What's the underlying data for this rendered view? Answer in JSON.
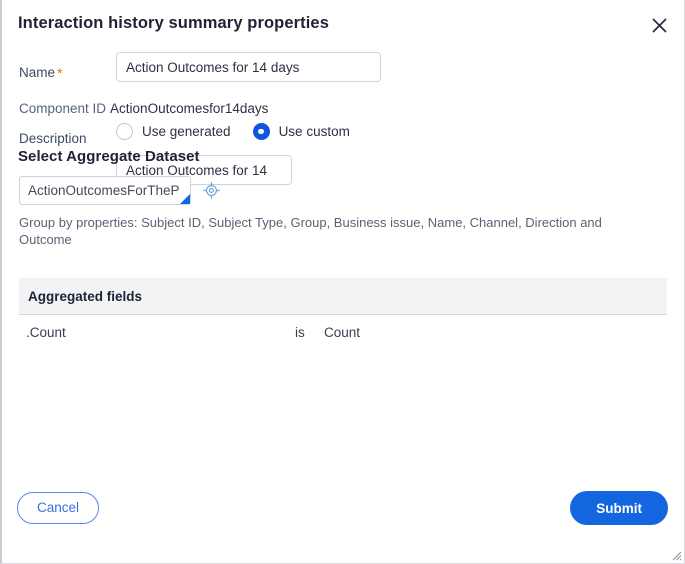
{
  "dialog": {
    "title": "Interaction history summary properties",
    "close_icon": "close-icon"
  },
  "form": {
    "name": {
      "label": "Name",
      "required_marker": "*",
      "value": "Action Outcomes for 14 days",
      "placeholder": ""
    },
    "component_id": {
      "label": "Component ID",
      "value": "ActionOutcomesfor14days"
    },
    "description": {
      "label": "Description",
      "options": [
        {
          "label": "Use generated",
          "selected": false
        },
        {
          "label": "Use custom",
          "selected": true
        }
      ],
      "value": "Action Outcomes for 14",
      "placeholder": ""
    }
  },
  "aggregate": {
    "section_title": "Select Aggregate Dataset",
    "dataset_value": "ActionOutcomesForTheP",
    "dataset_placeholder": "",
    "target_icon": "crosshair-target-icon",
    "group_by_text": "Group by properties: Subject ID, Subject Type, Group, Business issue, Name, Channel, Direction and Outcome"
  },
  "table": {
    "header": "Aggregated fields",
    "rows": [
      {
        "field": ".Count",
        "operator": "is",
        "value": "Count"
      }
    ]
  },
  "footer": {
    "cancel_label": "Cancel",
    "submit_label": "Submit"
  },
  "colors": {
    "accent_blue": "#1466e0",
    "required_orange": "#d9730d",
    "header_grey": "#f2f3f5",
    "text_dark": "#1f2235"
  }
}
